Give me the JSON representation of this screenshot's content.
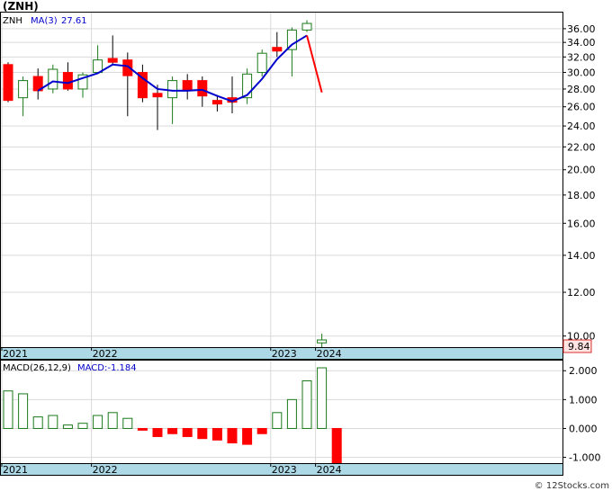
{
  "header": {
    "symbol_title": "(ZNH)",
    "legend_symbol": "ZNH",
    "legend_ma": "MA(3)",
    "legend_ma_value": "27.61",
    "macd_label": "MACD(26,12,9)",
    "macd_value_label": "MACD:-1.184",
    "last_price_label": "9.84",
    "watermark": "© 12Stocks.com"
  },
  "colors": {
    "up_candle": "#1a7a1a",
    "down_candle": "#ff0000",
    "ma_line_blue": "#0000cc",
    "ma_line_red": "#ff0000",
    "axis_band": "#add8e6",
    "grid": "#d9d9d9",
    "macd_positive": "#1a7a1a",
    "macd_negative": "#ff0000"
  },
  "chart_data": [
    {
      "type": "candlestick",
      "scale": "log",
      "ylim": [
        9.84,
        38.5
      ],
      "y_ticks": [
        "36.00",
        "34.00",
        "32.00",
        "30.00",
        "28.00",
        "26.00",
        "24.00",
        "22.00",
        "20.00",
        "18.00",
        "16.00",
        "14.00",
        "12.00",
        "10.00"
      ],
      "x_tick_labels": [
        "2021",
        "2022",
        "2023",
        "2024"
      ],
      "x_tick_index": [
        0,
        6,
        18,
        21
      ],
      "last_price": 9.84,
      "candles": [
        {
          "o": 31.0,
          "h": 31.3,
          "l": 26.5,
          "c": 26.7
        },
        {
          "o": 27.0,
          "h": 29.5,
          "l": 25.0,
          "c": 29.0
        },
        {
          "o": 29.5,
          "h": 30.5,
          "l": 26.8,
          "c": 27.8
        },
        {
          "o": 28.0,
          "h": 31.0,
          "l": 27.5,
          "c": 30.4
        },
        {
          "o": 30.0,
          "h": 31.3,
          "l": 27.8,
          "c": 28.0
        },
        {
          "o": 28.0,
          "h": 30.0,
          "l": 27.0,
          "c": 29.7
        },
        {
          "o": 30.0,
          "h": 33.6,
          "l": 29.8,
          "c": 31.6
        },
        {
          "o": 31.8,
          "h": 35.0,
          "l": 30.9,
          "c": 31.3
        },
        {
          "o": 31.6,
          "h": 32.6,
          "l": 25.0,
          "c": 29.6
        },
        {
          "o": 30.0,
          "h": 31.0,
          "l": 26.5,
          "c": 27.0
        },
        {
          "o": 27.5,
          "h": 28.5,
          "l": 23.6,
          "c": 27.1
        },
        {
          "o": 27.0,
          "h": 29.5,
          "l": 24.2,
          "c": 29.0
        },
        {
          "o": 29.0,
          "h": 29.8,
          "l": 26.8,
          "c": 27.8
        },
        {
          "o": 29.0,
          "h": 29.5,
          "l": 26.0,
          "c": 27.2
        },
        {
          "o": 26.7,
          "h": 27.3,
          "l": 25.5,
          "c": 26.3
        },
        {
          "o": 27.0,
          "h": 29.5,
          "l": 25.3,
          "c": 26.5
        },
        {
          "o": 27.0,
          "h": 30.5,
          "l": 26.3,
          "c": 29.8
        },
        {
          "o": 30.0,
          "h": 33.0,
          "l": 29.5,
          "c": 32.5
        },
        {
          "o": 33.3,
          "h": 35.5,
          "l": 32.0,
          "c": 32.8
        },
        {
          "o": 33.0,
          "h": 36.2,
          "l": 29.5,
          "c": 35.8
        },
        {
          "o": 35.8,
          "h": 37.3,
          "l": 35.5,
          "c": 36.8
        },
        {
          "o": 9.72,
          "h": 10.1,
          "l": 9.55,
          "c": 9.84
        }
      ],
      "ma_series": [
        {
          "color": "blue",
          "values": [
            null,
            null,
            27.8,
            28.9,
            28.7,
            29.3,
            29.9,
            31.0,
            30.8,
            29.3,
            28.0,
            27.8,
            27.8,
            27.9,
            27.2,
            26.6,
            27.3,
            29.2,
            31.7,
            33.7,
            35.0,
            null
          ]
        },
        {
          "color": "red",
          "values": [
            null,
            null,
            null,
            null,
            null,
            null,
            null,
            null,
            null,
            null,
            null,
            null,
            null,
            null,
            null,
            null,
            null,
            null,
            null,
            null,
            35.0,
            27.61
          ]
        }
      ]
    },
    {
      "type": "bar",
      "title": "MACD(26,12,9)",
      "ylim": [
        -1.2,
        2.35
      ],
      "y_ticks": [
        "2.000",
        "1.000",
        "0.000",
        "-1.000"
      ],
      "x_tick_labels": [
        "2021",
        "2022",
        "2023",
        "2024"
      ],
      "x_tick_index": [
        0,
        6,
        18,
        21
      ],
      "values": [
        1.3,
        1.2,
        0.4,
        0.45,
        0.12,
        0.18,
        0.45,
        0.55,
        0.35,
        -0.06,
        -0.28,
        -0.18,
        -0.28,
        -0.35,
        -0.4,
        -0.5,
        -0.55,
        -0.18,
        0.55,
        1.0,
        1.65,
        2.1,
        -1.184
      ]
    }
  ]
}
